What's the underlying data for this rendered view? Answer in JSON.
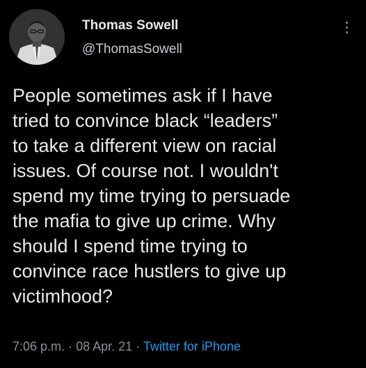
{
  "author": {
    "display_name": "Thomas Sowell",
    "handle": "@ThomasSowell"
  },
  "tweet": {
    "lines": [
      "People sometimes ask if I have",
      "tried to convince black “leaders”",
      "to take a different view on racial",
      "issues. Of course not. I wouldn't",
      "spend my time trying to persuade",
      "the mafia to give up crime. Why",
      "should I spend time trying to",
      "convince race hustlers to give up",
      "victimhood?"
    ]
  },
  "meta": {
    "time": "7:06 p.m.",
    "separator": "·",
    "date": "08 Apr. 21",
    "source": "Twitter for iPhone"
  },
  "icons": {
    "more": "more-vertical-icon"
  },
  "colors": {
    "background": "#000000",
    "text": "#e7e9ea",
    "secondary": "#8b8f94",
    "link": "#1d9bf0"
  }
}
